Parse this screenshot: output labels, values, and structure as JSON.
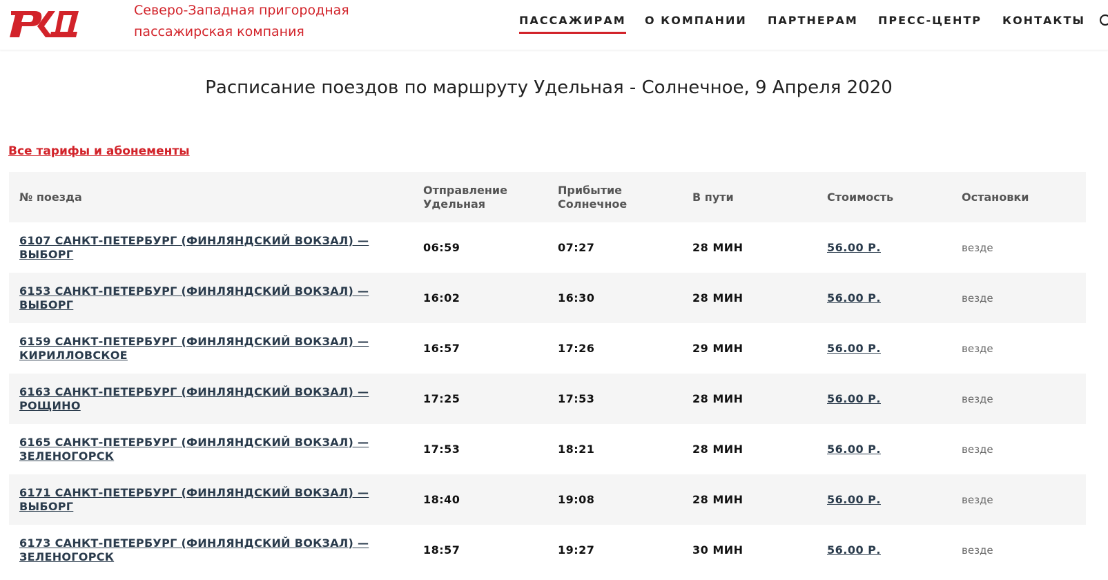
{
  "header": {
    "company_line1": "Северо-Западная пригородная",
    "company_line2": "пассажирская компания",
    "nav": [
      {
        "label": "ПАССАЖИРАМ",
        "active": true
      },
      {
        "label": "О КОМПАНИИ",
        "active": false
      },
      {
        "label": "ПАРТНЕРАМ",
        "active": false
      },
      {
        "label": "ПРЕСС-ЦЕНТР",
        "active": false
      },
      {
        "label": "КОНТАКТЫ",
        "active": false
      }
    ],
    "search_icon": "search-icon"
  },
  "colors": {
    "brand_red": "#d2232a",
    "link_dark": "#2a3b4c",
    "row_shade": "#f5f5f5"
  },
  "page": {
    "title": "Расписание поездов по маршруту Удельная - Солнечное, 9 Апреля 2020",
    "tariffs_link": "Все тарифы и абонементы"
  },
  "table": {
    "headers": {
      "train": "№ поезда",
      "departure_line1": "Отправление",
      "departure_line2": "Удельная",
      "arrival_line1": "Прибытие",
      "arrival_line2": "Солнечное",
      "duration": "В пути",
      "cost": "Стоимость",
      "stops": "Остановки"
    },
    "rows": [
      {
        "train": "6107 САНКТ-ПЕТЕРБУРГ (ФИНЛЯНДСКИЙ ВОКЗАЛ) — ВЫБОРГ",
        "departure": "06:59",
        "arrival": "07:27",
        "duration": "28 МИН",
        "cost": "56.00 Р.",
        "stops": "везде"
      },
      {
        "train": "6153 САНКТ-ПЕТЕРБУРГ (ФИНЛЯНДСКИЙ ВОКЗАЛ) — ВЫБОРГ",
        "departure": "16:02",
        "arrival": "16:30",
        "duration": "28 МИН",
        "cost": "56.00 Р.",
        "stops": "везде"
      },
      {
        "train": "6159 САНКТ-ПЕТЕРБУРГ (ФИНЛЯНДСКИЙ ВОКЗАЛ) — КИРИЛЛОВСКОЕ",
        "departure": "16:57",
        "arrival": "17:26",
        "duration": "29 МИН",
        "cost": "56.00 Р.",
        "stops": "везде"
      },
      {
        "train": "6163 САНКТ-ПЕТЕРБУРГ (ФИНЛЯНДСКИЙ ВОКЗАЛ) — РОЩИНО",
        "departure": "17:25",
        "arrival": "17:53",
        "duration": "28 МИН",
        "cost": "56.00 Р.",
        "stops": "везде"
      },
      {
        "train": "6165 САНКТ-ПЕТЕРБУРГ (ФИНЛЯНДСКИЙ ВОКЗАЛ) — ЗЕЛЕНОГОРСК",
        "departure": "17:53",
        "arrival": "18:21",
        "duration": "28 МИН",
        "cost": "56.00 Р.",
        "stops": "везде"
      },
      {
        "train": "6171 САНКТ-ПЕТЕРБУРГ (ФИНЛЯНДСКИЙ ВОКЗАЛ) — ВЫБОРГ",
        "departure": "18:40",
        "arrival": "19:08",
        "duration": "28 МИН",
        "cost": "56.00 Р.",
        "stops": "везде"
      },
      {
        "train": "6173 САНКТ-ПЕТЕРБУРГ (ФИНЛЯНДСКИЙ ВОКЗАЛ) — ЗЕЛЕНОГОРСК",
        "departure": "18:57",
        "arrival": "19:27",
        "duration": "30 МИН",
        "cost": "56.00 Р.",
        "stops": "везде"
      }
    ]
  }
}
